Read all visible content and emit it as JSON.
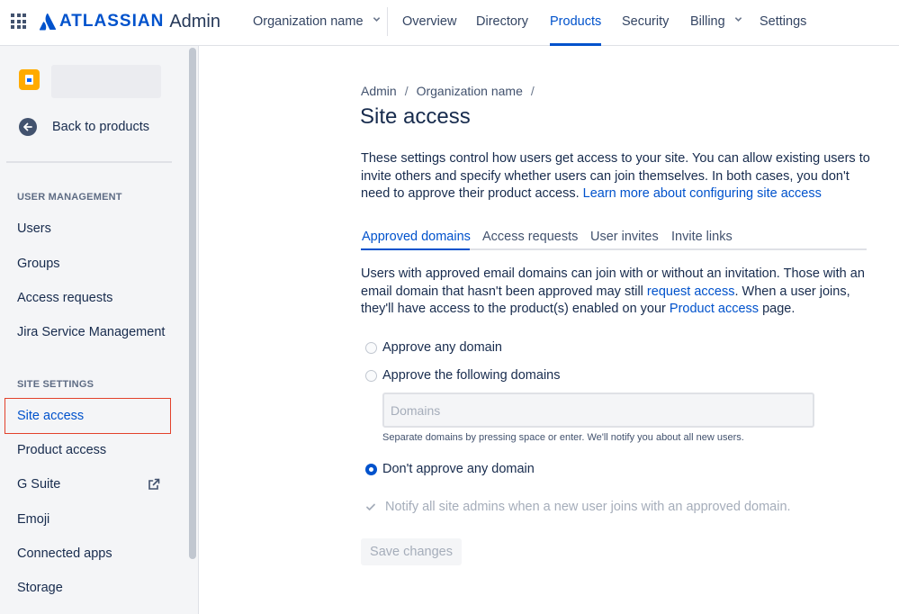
{
  "header": {
    "brand": "ATLASSIAN",
    "product": "Admin",
    "nav": [
      {
        "label": "Organization name",
        "dropdown": true
      },
      {
        "label": "Overview"
      },
      {
        "label": "Directory"
      },
      {
        "label": "Products",
        "active": true
      },
      {
        "label": "Security"
      },
      {
        "label": "Billing",
        "dropdown": true
      },
      {
        "label": "Settings"
      }
    ]
  },
  "sidebar": {
    "back_label": "Back to products",
    "user_management": {
      "heading": "USER MANAGEMENT",
      "items": [
        "Users",
        "Groups",
        "Access requests",
        "Jira Service Management"
      ]
    },
    "site_settings": {
      "heading": "SITE SETTINGS",
      "items": [
        "Site access",
        "Product access",
        "G Suite",
        "Emoji",
        "Connected apps",
        "Storage"
      ],
      "active": "Site access"
    }
  },
  "main": {
    "breadcrumb": [
      "Admin",
      "Organization name"
    ],
    "title": "Site access",
    "description": "These settings control how users get access to your site. You can allow existing users to invite others and specify whether users can join themselves. In both cases, you don't need to approve their product access.",
    "description_link": "Learn more about configuring site access",
    "tabs": [
      {
        "label": "Approved domains",
        "active": true
      },
      {
        "label": "Access requests"
      },
      {
        "label": "User invites"
      },
      {
        "label": "Invite links"
      }
    ],
    "domain_text_1": "Users with approved email domains can join with or without an invitation. Those with an email domain that hasn't been approved may still",
    "domain_link_1": "request access",
    "domain_text_2": ". When a user joins, they'll have access to the product(s) enabled on your",
    "domain_link_2": "Product access",
    "domain_text_3": "page.",
    "options": [
      {
        "label": "Approve any domain",
        "checked": false
      },
      {
        "label": "Approve the following domains",
        "checked": false
      },
      {
        "label": "Don't approve any domain",
        "checked": true
      }
    ],
    "domains_placeholder": "Domains",
    "domains_helper": "Separate domains by pressing space or enter. We'll notify you about all new users.",
    "notify_label": "Notify all site admins when a new user joins with an approved domain.",
    "save_label": "Save changes"
  },
  "colors": {
    "accent": "#0052CC",
    "highlight_box": "#E2412B",
    "product_icon": "#FFAB00"
  }
}
